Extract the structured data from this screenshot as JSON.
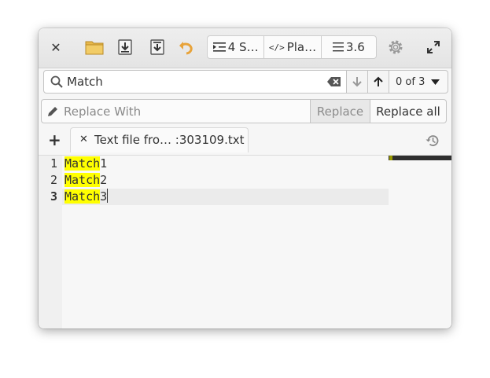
{
  "window": {
    "tab_bar": {
      "tabs": [
        {
          "label": "Text file fro…  :303109.txt"
        }
      ]
    },
    "toolbar": {
      "indent_label": "4 S…",
      "language_label": "Pla…",
      "line_spacing_label": "3.6"
    },
    "search": {
      "query": "Match",
      "counter": "0 of 3"
    },
    "replace": {
      "placeholder": "Replace With",
      "replace_label": "Replace",
      "replace_all_label": "Replace all"
    },
    "editor": {
      "lines": [
        {
          "number": "1",
          "match": "Match",
          "rest": "1"
        },
        {
          "number": "2",
          "match": "Match",
          "rest": "2"
        },
        {
          "number": "3",
          "match": "Match",
          "rest": "3"
        }
      ],
      "current_line": 3
    }
  },
  "colors": {
    "match_highlight": "#ffff00",
    "current_line": "#ebebeb",
    "folder_icon": "#e8b84a",
    "undo_icon": "#e8a33a"
  },
  "icons": [
    "close-icon",
    "folder-icon",
    "save-icon",
    "save-as-icon",
    "revert-icon",
    "indent-icon",
    "code-icon",
    "line-spacing-icon",
    "gear-icon",
    "fullscreen-icon",
    "search-icon",
    "clear-text-icon",
    "arrow-down-icon",
    "arrow-up-icon",
    "chevron-down-icon",
    "pencil-icon",
    "add-icon",
    "history-icon"
  ]
}
